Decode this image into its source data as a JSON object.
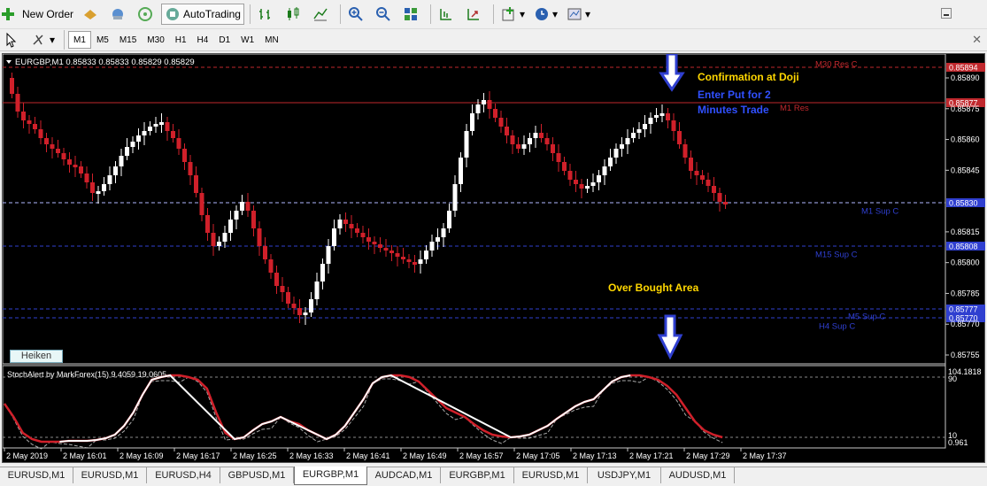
{
  "toolbar": {
    "new_order_label": "New Order",
    "autotrading_label": "AutoTrading",
    "timeframes": [
      "M1",
      "M5",
      "M15",
      "M30",
      "H1",
      "H4",
      "D1",
      "W1",
      "MN"
    ],
    "selected_timeframe": "M1"
  },
  "chart": {
    "header": "EURGBP,M1  0.85833 0.85833 0.85829 0.85829",
    "heiken_label": "Heiken",
    "annotations": {
      "confirmation": "Confirmation at Doji",
      "enter_put": "Enter Put for 2",
      "minutes_trade": "Minutes Trade",
      "over_bought": "Over Bought Area"
    },
    "levels": [
      {
        "label": "M30 Res C",
        "price_label": "0.85894",
        "color": "#c0282d"
      },
      {
        "label": "M1 Res",
        "price_label": "0.85877",
        "color": "#c0282d"
      },
      {
        "label": "M1 Sup C",
        "price_label": "0.85830",
        "color": "#2f3fd0"
      },
      {
        "label": "M15 Sup C",
        "price_label": "0.85808",
        "color": "#2f3fd0"
      },
      {
        "label": "M5 Sup C",
        "price_label": "0.85777",
        "color": "#2f3fd0"
      },
      {
        "label": "H4 Sup C",
        "price_label": "0.85770",
        "color": "#2f3fd0"
      }
    ],
    "price_ticks": [
      "0.85890",
      "0.85875",
      "0.85860",
      "0.85845",
      "0.85815",
      "0.85800",
      "0.85785",
      "0.85770",
      "0.85755"
    ],
    "time_ticks": [
      "2 May 2019",
      "2 May 16:01",
      "2 May 16:09",
      "2 May 16:17",
      "2 May 16:25",
      "2 May 16:33",
      "2 May 16:41",
      "2 May 16:49",
      "2 May 16:57",
      "2 May 17:05",
      "2 May 17:13",
      "2 May 17:21",
      "2 May 17:29",
      "2 May 17:37"
    ],
    "stoch": {
      "header": "StochAlert by MarkForex(15) 9.4059 19.0605",
      "top_label": "104.1818",
      "level_90": "90",
      "level_10": "10",
      "bottom_label": "0.961"
    }
  },
  "tabs": [
    "EURUSD,M1",
    "EURUSD,M1",
    "EURUSD,H4",
    "GBPUSD,M1",
    "EURGBP,M1",
    "AUDCAD,M1",
    "EURGBP,M1",
    "EURUSD,M1",
    "USDJPY,M1",
    "AUDUSD,M1"
  ],
  "active_tab_index": 4,
  "colors": {
    "bull": "#ffffff",
    "bear": "#d0202a",
    "stoch_main": "#d0202a",
    "annotation_yellow": "#ffd700",
    "annotation_blue": "#3050ff"
  }
}
